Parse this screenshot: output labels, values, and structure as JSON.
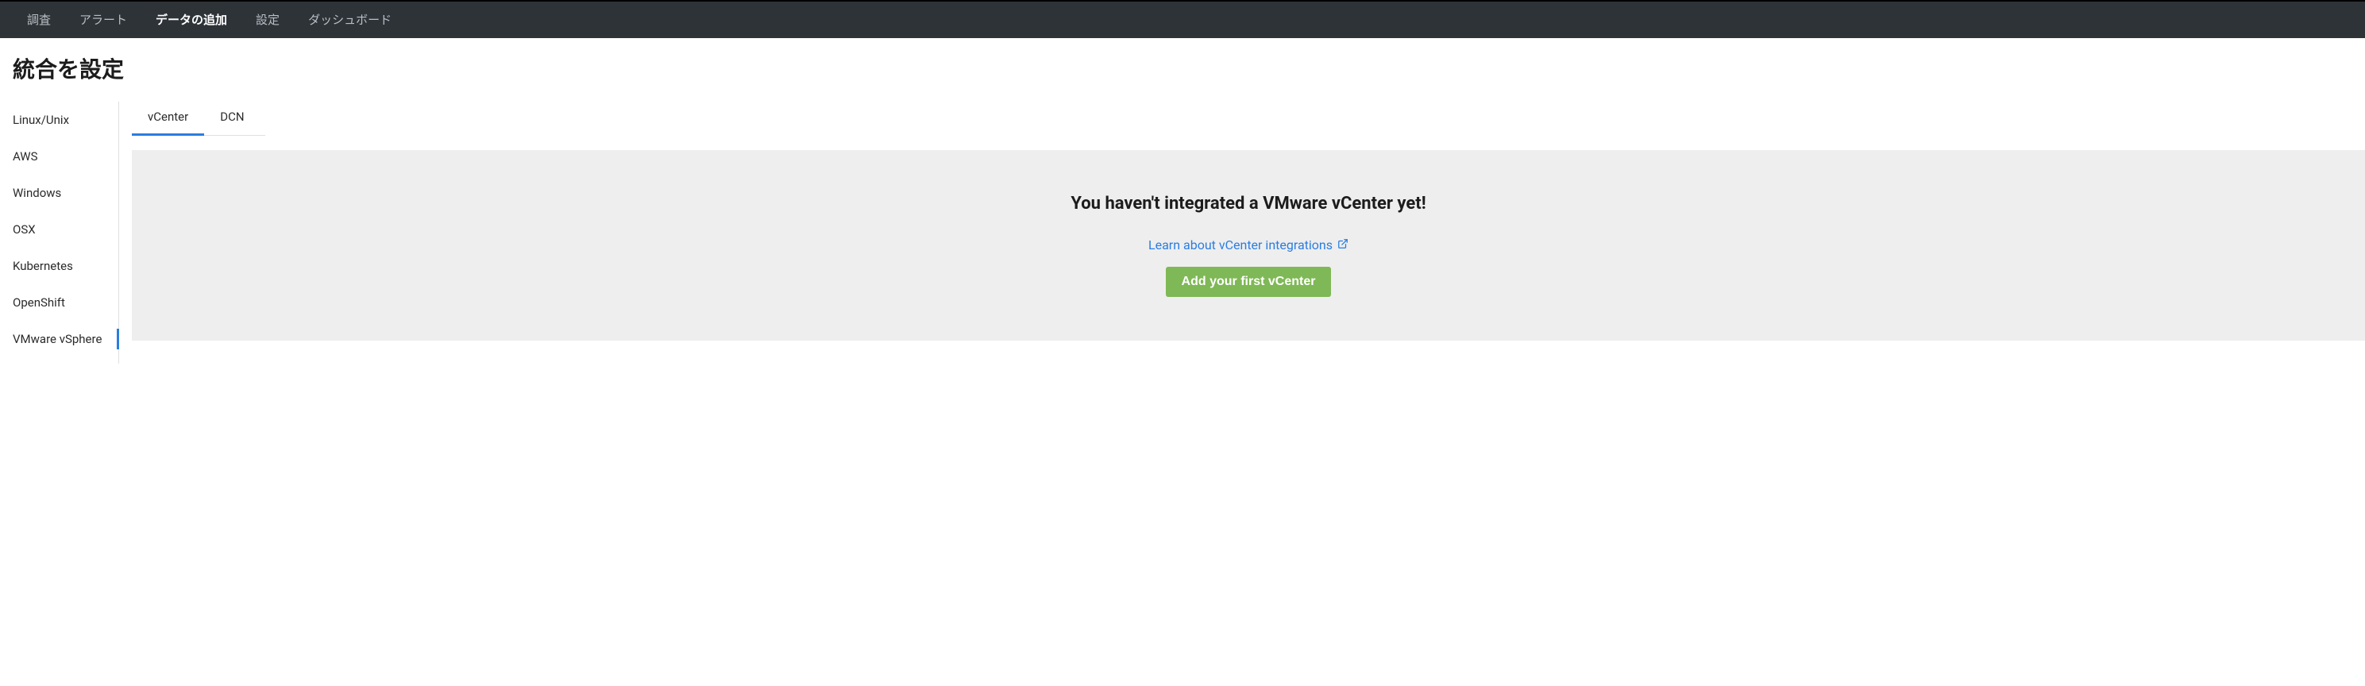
{
  "nav": {
    "items": [
      {
        "label": "調査",
        "active": false
      },
      {
        "label": "アラート",
        "active": false
      },
      {
        "label": "データの追加",
        "active": true
      },
      {
        "label": "設定",
        "active": false
      },
      {
        "label": "ダッシュボード",
        "active": false
      }
    ]
  },
  "page": {
    "title": "統合を設定"
  },
  "sidebar": {
    "items": [
      {
        "label": "Linux/Unix",
        "active": false
      },
      {
        "label": "AWS",
        "active": false
      },
      {
        "label": "Windows",
        "active": false
      },
      {
        "label": "OSX",
        "active": false
      },
      {
        "label": "Kubernetes",
        "active": false
      },
      {
        "label": "OpenShift",
        "active": false
      },
      {
        "label": "VMware vSphere",
        "active": true
      }
    ]
  },
  "tabs": {
    "items": [
      {
        "label": "vCenter",
        "active": true
      },
      {
        "label": "DCN",
        "active": false
      }
    ]
  },
  "empty_state": {
    "title": "You haven't integrated a VMware vCenter yet!",
    "learn_link": "Learn about vCenter integrations",
    "button": "Add your first vCenter"
  },
  "colors": {
    "nav_bg": "#2e3338",
    "accent": "#2a7de1",
    "button_bg": "#7fb856",
    "panel_bg": "#eeeeee"
  }
}
